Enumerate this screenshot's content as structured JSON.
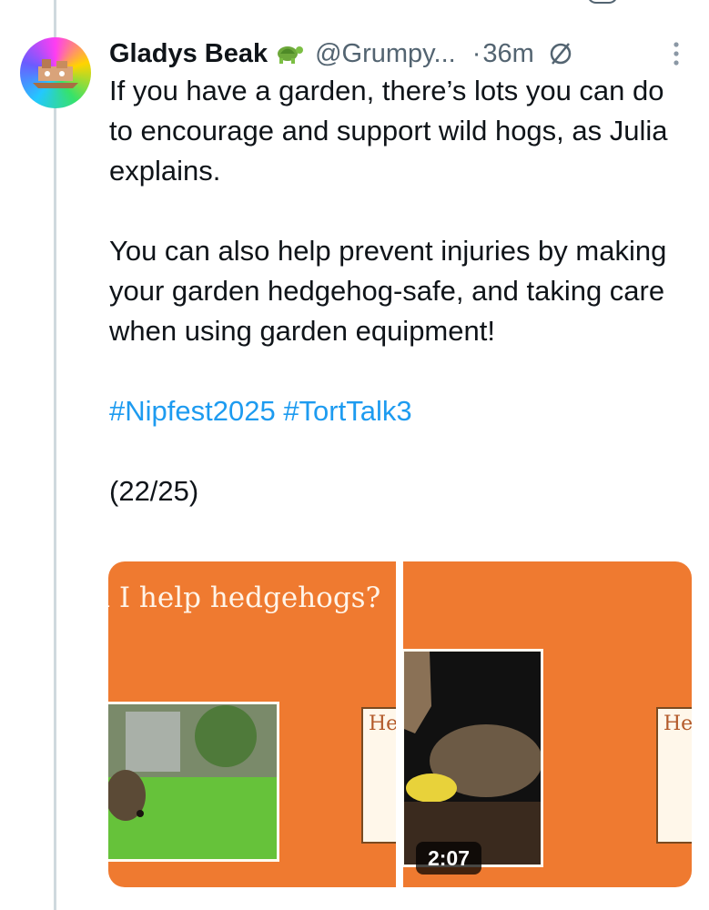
{
  "tweet": {
    "display_name": "Gladys Beak",
    "name_emoji": "turtle-emoji",
    "handle": "@Grumpy...",
    "separator": "·",
    "time": "36m",
    "text_lines": {
      "p1": "If you have a garden, there’s lots you can do to encourage and support wild hogs, as Julia explains.",
      "p2": "You can also help prevent injuries by making your garden hedgehog-safe, and taking care when using garden equipment!",
      "hashtag1": "#Nipfest2025",
      "hashtag2": "#TortTalk3",
      "counter": "(22/25)"
    }
  },
  "media": {
    "left_slide_title": "n I help hedgehogs?",
    "left_sign_text": "He",
    "right_sign_text": "He",
    "video_duration": "2:07"
  },
  "colors": {
    "accent_link": "#1d9bf0",
    "slide_orange": "#ef7a30",
    "secondary_text": "#536471"
  },
  "icons": {
    "sync": "circle-slash-icon",
    "more": "more-vertical-icon"
  }
}
